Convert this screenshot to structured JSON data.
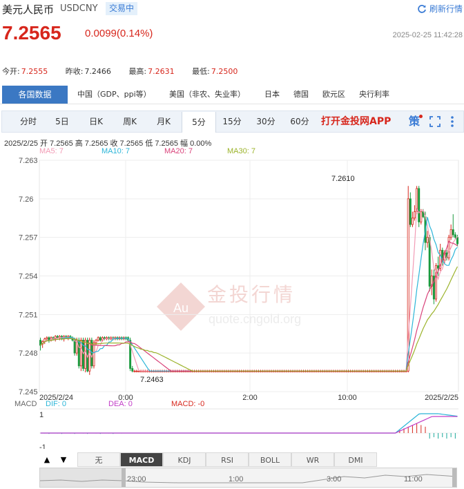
{
  "header": {
    "name": "美元人民币",
    "code": "USDCNY",
    "status": "交易中",
    "refresh_label": "刷新行情"
  },
  "quote": {
    "price": "7.2565",
    "change": "0.0099(0.14%)",
    "timestamp": "2025-02-25 11:42:28",
    "accent": "#d7261c"
  },
  "stats": {
    "today_open_label": "今开:",
    "today_open": "7.2555",
    "prev_close_label": "昨收:",
    "prev_close": "7.2466",
    "high_label": "最高:",
    "high": "7.2631",
    "low_label": "最低:",
    "low": "7.2500"
  },
  "regions": [
    "各国数据",
    "中国（GDP、ppi等）",
    "美国（非农、失业率）",
    "日本",
    "德国",
    "欧元区",
    "央行利率"
  ],
  "timeframes": [
    "分时",
    "5日",
    "日K",
    "周K",
    "月K",
    "5分",
    "15分",
    "30分",
    "60分"
  ],
  "active_timeframe": "5分",
  "app_promo": "打开金投网APP",
  "ce_label": "策",
  "ohlc_line": "2025/2/25  开 7.2565  高 7.2565  收 7.2565  低 7.2565  幅 0.00%",
  "ma_labels": [
    {
      "text": "MA5: 7",
      "color": "#f29bb5"
    },
    {
      "text": "MA10: 7",
      "color": "#2bb5d8"
    },
    {
      "text": "MA20: 7",
      "color": "#d9427a"
    },
    {
      "text": "MA30: 7",
      "color": "#9bb32a"
    }
  ],
  "watermark": {
    "cn": "金投行情",
    "en": "quote.cngold.org",
    "logo": "Au"
  },
  "chart_data": {
    "type": "candlestick",
    "y_ticks": [
      "7.263",
      "7.26",
      "7.257",
      "7.254",
      "7.251",
      "7.248",
      "7.245"
    ],
    "ylim": [
      7.245,
      7.263
    ],
    "x_labels": [
      "2025/2/24",
      "0:00",
      "2:00",
      "10:00",
      "2025/2/25"
    ],
    "annotations": {
      "max": "7.2610",
      "min": "7.2463"
    },
    "candles": [
      [
        7.249,
        7.2486,
        7.2492,
        7.2482
      ],
      [
        7.2487,
        7.2489,
        7.249,
        7.2484
      ],
      [
        7.2489,
        7.2491,
        7.2492,
        7.2487
      ],
      [
        7.2491,
        7.2492,
        7.2493,
        7.2489
      ],
      [
        7.2492,
        7.249,
        7.2493,
        7.2488
      ],
      [
        7.249,
        7.2492,
        7.2493,
        7.2489
      ],
      [
        7.2492,
        7.2491,
        7.2493,
        7.249
      ],
      [
        7.2491,
        7.2493,
        7.2494,
        7.2489
      ],
      [
        7.2493,
        7.2492,
        7.2494,
        7.2491
      ],
      [
        7.2492,
        7.2493,
        7.2494,
        7.249
      ],
      [
        7.2493,
        7.2491,
        7.2494,
        7.249
      ],
      [
        7.2491,
        7.2493,
        7.2494,
        7.2489
      ],
      [
        7.2493,
        7.2492,
        7.2494,
        7.2491
      ],
      [
        7.2492,
        7.2493,
        7.2494,
        7.249
      ],
      [
        7.2493,
        7.2492,
        7.2494,
        7.2491
      ],
      [
        7.2492,
        7.249,
        7.2493,
        7.2489
      ],
      [
        7.249,
        7.248,
        7.2492,
        7.2478
      ],
      [
        7.248,
        7.249,
        7.2492,
        7.2478
      ],
      [
        7.249,
        7.247,
        7.2492,
        7.2468
      ],
      [
        7.247,
        7.249,
        7.2492,
        7.2466
      ],
      [
        7.249,
        7.2468,
        7.2492,
        7.2466
      ],
      [
        7.2468,
        7.249,
        7.2492,
        7.2465
      ],
      [
        7.249,
        7.2466,
        7.2492,
        7.2465
      ],
      [
        7.2466,
        7.249,
        7.2492,
        7.2463
      ],
      [
        7.249,
        7.247,
        7.2492,
        7.2468
      ],
      [
        7.247,
        7.2488,
        7.249,
        7.2468
      ],
      [
        7.2488,
        7.249,
        7.2491,
        7.2486
      ],
      [
        7.249,
        7.2492,
        7.2493,
        7.2489
      ],
      [
        7.2492,
        7.249,
        7.2493,
        7.2489
      ],
      [
        7.249,
        7.2492,
        7.2493,
        7.2489
      ],
      [
        7.2492,
        7.2491,
        7.2493,
        7.249
      ],
      [
        7.2491,
        7.2492,
        7.2493,
        7.249
      ],
      [
        7.2492,
        7.2491,
        7.2493,
        7.249
      ],
      [
        7.2491,
        7.2492,
        7.2493,
        7.249
      ],
      [
        7.2492,
        7.2491,
        7.2493,
        7.249
      ],
      [
        7.2491,
        7.2492,
        7.2493,
        7.249
      ],
      [
        7.2492,
        7.2491,
        7.2493,
        7.249
      ],
      [
        7.2491,
        7.2492,
        7.2493,
        7.249
      ],
      [
        7.2492,
        7.2491,
        7.2493,
        7.249
      ],
      [
        7.2491,
        7.2492,
        7.2493,
        7.249
      ],
      [
        7.2492,
        7.2491,
        7.2493,
        7.249
      ],
      [
        7.2492,
        7.249,
        7.2493,
        7.2489
      ],
      [
        7.249,
        7.2468,
        7.2492,
        7.2466
      ],
      [
        7.2468,
        7.2466,
        7.247,
        7.2465
      ],
      [
        7.2466,
        7.2466,
        7.2467,
        7.2465
      ],
      [
        7.2466,
        7.2466,
        7.2467,
        7.2465
      ],
      [
        7.2466,
        7.2466,
        7.2467,
        7.2465
      ],
      [
        7.2466,
        7.2466,
        7.2467,
        7.2465
      ],
      [
        7.2466,
        7.2466,
        7.2467,
        7.2465
      ],
      [
        7.2466,
        7.2466,
        7.2467,
        7.2465
      ],
      [
        7.2466,
        7.2466,
        7.2467,
        7.2465
      ],
      [
        7.2466,
        7.2466,
        7.2467,
        7.2465
      ],
      [
        7.2466,
        7.2466,
        7.2467,
        7.2465
      ],
      [
        7.2466,
        7.2466,
        7.2467,
        7.2465
      ],
      [
        7.2466,
        7.2466,
        7.2467,
        7.2465
      ],
      [
        7.2466,
        7.2466,
        7.2467,
        7.2465
      ],
      [
        7.2466,
        7.2466,
        7.2467,
        7.2465
      ],
      [
        7.2466,
        7.2466,
        7.2467,
        7.2465
      ],
      [
        7.2466,
        7.2466,
        7.2467,
        7.2465
      ],
      [
        7.2466,
        7.2466,
        7.2467,
        7.2465
      ],
      [
        7.2466,
        7.2466,
        7.2467,
        7.2465
      ],
      [
        7.2466,
        7.2466,
        7.2467,
        7.2465
      ],
      [
        7.2466,
        7.2466,
        7.2467,
        7.2465
      ],
      [
        7.2466,
        7.2466,
        7.2467,
        7.2465
      ],
      [
        7.2466,
        7.2466,
        7.2467,
        7.2465
      ],
      [
        7.2466,
        7.2466,
        7.2467,
        7.2465
      ],
      [
        7.2466,
        7.2466,
        7.2467,
        7.2465
      ],
      [
        7.2466,
        7.2466,
        7.2467,
        7.2465
      ],
      [
        7.2466,
        7.2466,
        7.2467,
        7.2465
      ],
      [
        7.2466,
        7.2466,
        7.2467,
        7.2465
      ],
      [
        7.2466,
        7.2466,
        7.2467,
        7.2465
      ],
      [
        7.2466,
        7.2466,
        7.2467,
        7.2465
      ],
      [
        7.2466,
        7.2466,
        7.2467,
        7.2465
      ],
      [
        7.2466,
        7.2466,
        7.2467,
        7.2465
      ],
      [
        7.2466,
        7.2466,
        7.2467,
        7.2465
      ],
      [
        7.2466,
        7.2466,
        7.2467,
        7.2465
      ],
      [
        7.2466,
        7.2466,
        7.2467,
        7.2465
      ],
      [
        7.2466,
        7.2466,
        7.2467,
        7.2465
      ],
      [
        7.2466,
        7.2466,
        7.2467,
        7.2465
      ],
      [
        7.2466,
        7.2466,
        7.2467,
        7.2465
      ],
      [
        7.2466,
        7.2466,
        7.2467,
        7.2465
      ],
      [
        7.2466,
        7.2466,
        7.2467,
        7.2465
      ],
      [
        7.2466,
        7.2466,
        7.2467,
        7.2465
      ],
      [
        7.2466,
        7.2466,
        7.2467,
        7.2465
      ],
      [
        7.2466,
        7.2466,
        7.2467,
        7.2465
      ],
      [
        7.2466,
        7.2466,
        7.2467,
        7.2465
      ],
      [
        7.2466,
        7.2466,
        7.2467,
        7.2465
      ],
      [
        7.2466,
        7.2466,
        7.2467,
        7.2465
      ],
      [
        7.2466,
        7.2466,
        7.2467,
        7.2465
      ],
      [
        7.2466,
        7.2466,
        7.2467,
        7.2465
      ],
      [
        7.2466,
        7.2466,
        7.2467,
        7.2465
      ],
      [
        7.2466,
        7.2466,
        7.2467,
        7.2465
      ],
      [
        7.2466,
        7.2466,
        7.2467,
        7.2465
      ],
      [
        7.2466,
        7.2466,
        7.2467,
        7.2465
      ],
      [
        7.2466,
        7.2466,
        7.2467,
        7.2465
      ],
      [
        7.2466,
        7.2466,
        7.2467,
        7.2465
      ],
      [
        7.2466,
        7.2466,
        7.2467,
        7.2465
      ],
      [
        7.2466,
        7.2466,
        7.2467,
        7.2465
      ],
      [
        7.2466,
        7.2466,
        7.2467,
        7.2465
      ],
      [
        7.2466,
        7.2466,
        7.2467,
        7.2465
      ],
      [
        7.2466,
        7.2466,
        7.2467,
        7.2465
      ],
      [
        7.2466,
        7.2466,
        7.2467,
        7.2465
      ],
      [
        7.2466,
        7.2466,
        7.2467,
        7.2465
      ],
      [
        7.2466,
        7.2466,
        7.2467,
        7.2465
      ],
      [
        7.2466,
        7.2466,
        7.2467,
        7.2465
      ],
      [
        7.2466,
        7.2466,
        7.2467,
        7.2465
      ],
      [
        7.2466,
        7.2466,
        7.2467,
        7.2465
      ],
      [
        7.2466,
        7.2466,
        7.2467,
        7.2465
      ],
      [
        7.2466,
        7.2466,
        7.2467,
        7.2465
      ],
      [
        7.2466,
        7.2466,
        7.2467,
        7.2465
      ],
      [
        7.2466,
        7.2466,
        7.2467,
        7.2465
      ],
      [
        7.2466,
        7.2466,
        7.2467,
        7.2465
      ],
      [
        7.2466,
        7.2466,
        7.2467,
        7.2465
      ],
      [
        7.2466,
        7.2466,
        7.2467,
        7.2465
      ],
      [
        7.2466,
        7.2466,
        7.2467,
        7.2465
      ],
      [
        7.2466,
        7.2466,
        7.2467,
        7.2465
      ],
      [
        7.2466,
        7.2466,
        7.2467,
        7.2465
      ],
      [
        7.2466,
        7.2466,
        7.2467,
        7.2465
      ],
      [
        7.2466,
        7.2466,
        7.2467,
        7.2465
      ],
      [
        7.2466,
        7.2466,
        7.2467,
        7.2465
      ],
      [
        7.2466,
        7.2466,
        7.2467,
        7.2465
      ],
      [
        7.2466,
        7.2466,
        7.2467,
        7.2465
      ],
      [
        7.2466,
        7.2466,
        7.2467,
        7.2465
      ],
      [
        7.2466,
        7.2466,
        7.2467,
        7.2465
      ],
      [
        7.2466,
        7.2466,
        7.2467,
        7.2465
      ],
      [
        7.2466,
        7.2466,
        7.2467,
        7.2465
      ],
      [
        7.2466,
        7.2466,
        7.2467,
        7.2465
      ],
      [
        7.2466,
        7.2466,
        7.2467,
        7.2465
      ],
      [
        7.2466,
        7.2466,
        7.2467,
        7.2465
      ],
      [
        7.2466,
        7.2466,
        7.2467,
        7.2465
      ],
      [
        7.2466,
        7.2466,
        7.2467,
        7.2465
      ],
      [
        7.2466,
        7.2466,
        7.2467,
        7.2465
      ],
      [
        7.2466,
        7.2466,
        7.2467,
        7.2465
      ],
      [
        7.2466,
        7.2466,
        7.2467,
        7.2465
      ],
      [
        7.2466,
        7.2466,
        7.2467,
        7.2465
      ],
      [
        7.2466,
        7.2466,
        7.2467,
        7.2465
      ],
      [
        7.2466,
        7.2466,
        7.2467,
        7.2465
      ],
      [
        7.2466,
        7.2466,
        7.2467,
        7.2465
      ],
      [
        7.2466,
        7.2466,
        7.2467,
        7.2465
      ],
      [
        7.2466,
        7.2466,
        7.2467,
        7.2465
      ],
      [
        7.2466,
        7.2466,
        7.2467,
        7.2465
      ],
      [
        7.2466,
        7.2466,
        7.2467,
        7.2465
      ],
      [
        7.2466,
        7.2466,
        7.2467,
        7.2465
      ],
      [
        7.2466,
        7.2466,
        7.2467,
        7.2465
      ],
      [
        7.2466,
        7.2466,
        7.2467,
        7.2465
      ],
      [
        7.2466,
        7.2466,
        7.2467,
        7.2465
      ],
      [
        7.2466,
        7.2466,
        7.2467,
        7.2465
      ],
      [
        7.2466,
        7.2466,
        7.2467,
        7.2465
      ],
      [
        7.2466,
        7.2466,
        7.2467,
        7.2465
      ],
      [
        7.2466,
        7.2466,
        7.2467,
        7.2465
      ],
      [
        7.2466,
        7.2466,
        7.2467,
        7.2465
      ],
      [
        7.2466,
        7.2466,
        7.2467,
        7.2465
      ],
      [
        7.2466,
        7.2466,
        7.2467,
        7.2465
      ],
      [
        7.2466,
        7.2466,
        7.2467,
        7.2465
      ],
      [
        7.2466,
        7.2466,
        7.2467,
        7.2465
      ],
      [
        7.2466,
        7.2466,
        7.2467,
        7.2465
      ],
      [
        7.2466,
        7.2466,
        7.2467,
        7.2465
      ],
      [
        7.2466,
        7.2466,
        7.2467,
        7.2465
      ],
      [
        7.2466,
        7.2466,
        7.2467,
        7.2465
      ],
      [
        7.2466,
        7.2466,
        7.2467,
        7.2465
      ],
      [
        7.2466,
        7.2466,
        7.2467,
        7.2465
      ],
      [
        7.2466,
        7.2466,
        7.2467,
        7.2465
      ],
      [
        7.2466,
        7.2466,
        7.2467,
        7.2465
      ],
      [
        7.2466,
        7.2466,
        7.2467,
        7.2465
      ],
      [
        7.2466,
        7.2466,
        7.2467,
        7.2465
      ],
      [
        7.2466,
        7.2466,
        7.2467,
        7.2465
      ],
      [
        7.2466,
        7.2466,
        7.2467,
        7.2465
      ],
      [
        7.2466,
        7.2466,
        7.2467,
        7.2465
      ],
      [
        7.2466,
        7.2466,
        7.2467,
        7.2465
      ],
      [
        7.2466,
        7.2466,
        7.2467,
        7.2465
      ],
      [
        7.2466,
        7.2466,
        7.2467,
        7.2465
      ],
      [
        7.2466,
        7.2466,
        7.2467,
        7.2465
      ],
      [
        7.2466,
        7.26,
        7.261,
        7.2465
      ],
      [
        7.26,
        7.258,
        7.2605,
        7.2578
      ],
      [
        7.258,
        7.2585,
        7.259,
        7.2578
      ],
      [
        7.2585,
        7.259,
        7.2595,
        7.2583
      ],
      [
        7.259,
        7.2608,
        7.261,
        7.2588
      ],
      [
        7.2608,
        7.2582,
        7.261,
        7.2578
      ],
      [
        7.2582,
        7.259,
        7.2592,
        7.258
      ],
      [
        7.259,
        7.2586,
        7.2592,
        7.2585
      ],
      [
        7.2586,
        7.2566,
        7.259,
        7.256
      ],
      [
        7.2566,
        7.257,
        7.2575,
        7.2562
      ],
      [
        7.257,
        7.2532,
        7.2572,
        7.2528
      ],
      [
        7.2532,
        7.254,
        7.2545,
        7.2525
      ],
      [
        7.254,
        7.2522,
        7.2545,
        7.2518
      ],
      [
        7.2522,
        7.2548,
        7.255,
        7.252
      ],
      [
        7.2548,
        7.2546,
        7.2555,
        7.254
      ],
      [
        7.2546,
        7.256,
        7.2565,
        7.2544
      ],
      [
        7.256,
        7.2552,
        7.2562,
        7.2548
      ],
      [
        7.2552,
        7.2558,
        7.256,
        7.255
      ],
      [
        7.2558,
        7.2554,
        7.256,
        7.2552
      ],
      [
        7.2554,
        7.257,
        7.2572,
        7.2552
      ],
      [
        7.257,
        7.2576,
        7.258,
        7.2568
      ],
      [
        7.2576,
        7.2572,
        7.2588,
        7.257
      ],
      [
        7.2572,
        7.257,
        7.2574,
        7.2568
      ],
      [
        7.257,
        7.2565,
        7.2572,
        7.2563
      ]
    ],
    "ma": {
      "ma5": "#f29bb5",
      "ma10": "#2bb5d8",
      "ma20": "#d9427a",
      "ma30": "#9bb32a"
    },
    "up_color": "#d7261c",
    "down_color": "#1a9a3e"
  },
  "macd": {
    "label": "MACD",
    "dif_label": "DIF: 0",
    "dea_label": "DEA: 0",
    "macd_label": "MACD: -0",
    "y_ticks": [
      "1",
      "-1"
    ]
  },
  "indicator_tabs": [
    "无",
    "MACD",
    "KDJ",
    "RSI",
    "BOLL",
    "WR",
    "DMI"
  ],
  "active_indicator": "MACD",
  "navigator": {
    "labels": [
      "23:00",
      "1:00",
      "3:00",
      "11:00"
    ]
  }
}
